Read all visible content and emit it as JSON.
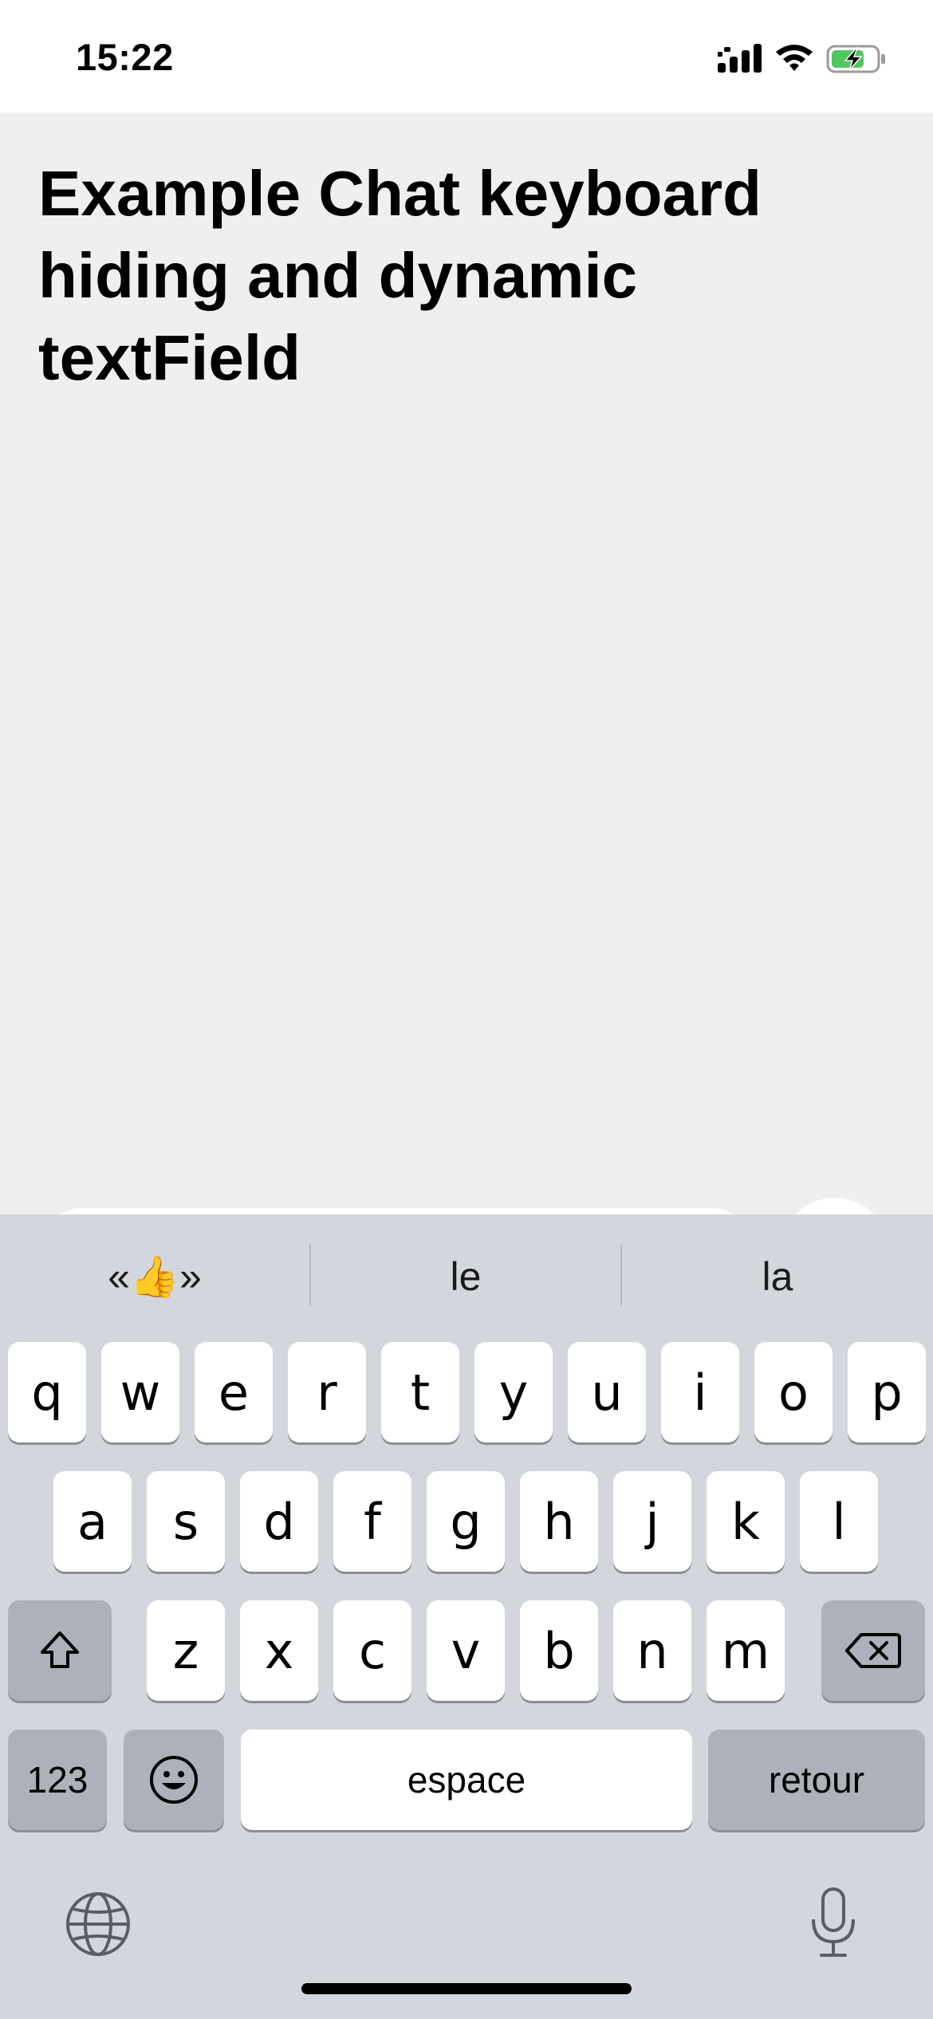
{
  "status_bar": {
    "time": "15:22"
  },
  "page": {
    "title": "Example Chat keyboard hiding and dynamic textField"
  },
  "composer": {
    "value": "👍"
  },
  "keyboard": {
    "suggestions": [
      "«👍»",
      "le",
      "la"
    ],
    "row1": [
      "q",
      "w",
      "e",
      "r",
      "t",
      "y",
      "u",
      "i",
      "o",
      "p"
    ],
    "row2": [
      "a",
      "s",
      "d",
      "f",
      "g",
      "h",
      "j",
      "k",
      "l"
    ],
    "row3": [
      "z",
      "x",
      "c",
      "v",
      "b",
      "n",
      "m"
    ],
    "numbers_label": "123",
    "space_label": "espace",
    "return_label": "retour"
  },
  "icons": {
    "shift": "shift-icon",
    "delete": "delete-icon",
    "emoji": "emoji-icon",
    "globe": "globe-icon",
    "microphone": "microphone-icon",
    "scribble": "scribble-icon"
  }
}
